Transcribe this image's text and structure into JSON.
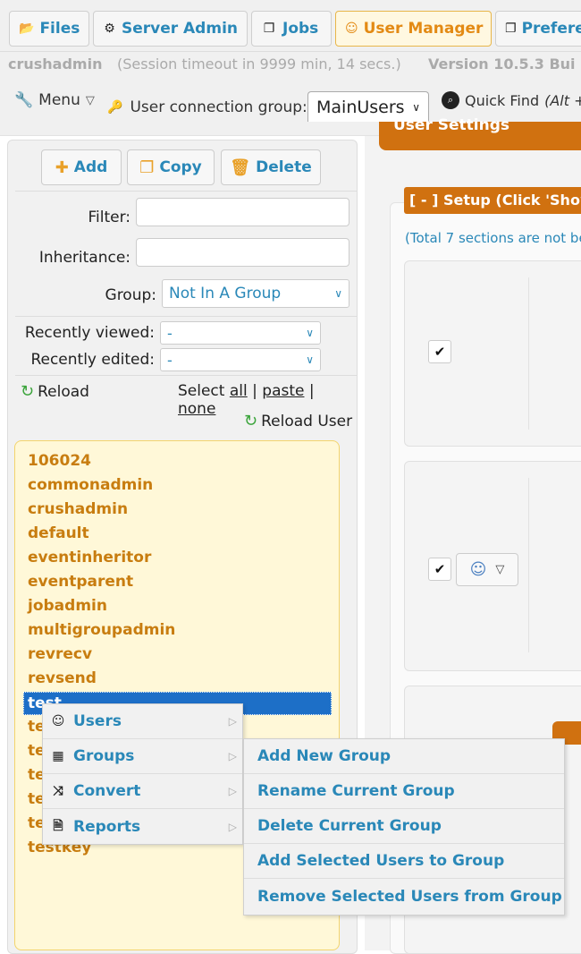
{
  "tabs": [
    {
      "label": "Files",
      "icon": "folder-icon"
    },
    {
      "label": "Server Admin",
      "icon": "gear-icon"
    },
    {
      "label": "Jobs",
      "icon": "copy-icon"
    },
    {
      "label": "User Manager",
      "icon": "user-icon",
      "active": true
    },
    {
      "label": "Prefere",
      "icon": "copy-icon"
    }
  ],
  "info": {
    "username": "crushadmin",
    "session": "(Session timeout in 9999 min, 14 secs.)",
    "version": "Version 10.5.3 Bui"
  },
  "toolbar": {
    "menu_label": "Menu",
    "connection_group_label": "User connection group:",
    "connection_group_value": "MainUsers",
    "quick_find_label": "Quick Find",
    "quick_find_shortcut": "(Alt +"
  },
  "actions": {
    "add": "Add",
    "copy": "Copy",
    "delete": "Delete"
  },
  "filters": {
    "filter_label": "Filter:",
    "filter_value": "",
    "inheritance_label": "Inheritance:",
    "inheritance_value": "",
    "group_label": "Group:",
    "group_value": "Not In A Group",
    "recently_viewed_label": "Recently viewed:",
    "recently_viewed_value": "-",
    "recently_edited_label": "Recently edited:",
    "recently_edited_value": "-"
  },
  "list_controls": {
    "reload": "Reload",
    "select_label": "Select",
    "select_all": "all",
    "paste": "paste",
    "none": "none",
    "sep": "|",
    "reload_user": "Reload User"
  },
  "users": [
    "106024",
    "commonadmin",
    "crushadmin",
    "default",
    "eventinheritor",
    "eventparent",
    "jobadmin",
    "multigroupadmin",
    "revrecv",
    "revsend"
  ],
  "selected_user": "test",
  "hidden_user_prefix": "te",
  "last_user": "testkey",
  "right": {
    "settings_header": "User Settings",
    "setup_header": "[ - ] Setup (Click 'Show",
    "total_note": "(Total 7 sections are not be"
  },
  "context_menu": {
    "items": [
      {
        "label": "Users",
        "icon": "users-icon"
      },
      {
        "label": "Groups",
        "icon": "grid-icon"
      },
      {
        "label": "Convert",
        "icon": "shuffle-icon"
      },
      {
        "label": "Reports",
        "icon": "report-icon"
      }
    ],
    "groups_submenu": [
      "Add New Group",
      "Rename Current Group",
      "Delete Current Group",
      "Add Selected Users to Group",
      "Remove Selected Users from Group"
    ]
  }
}
